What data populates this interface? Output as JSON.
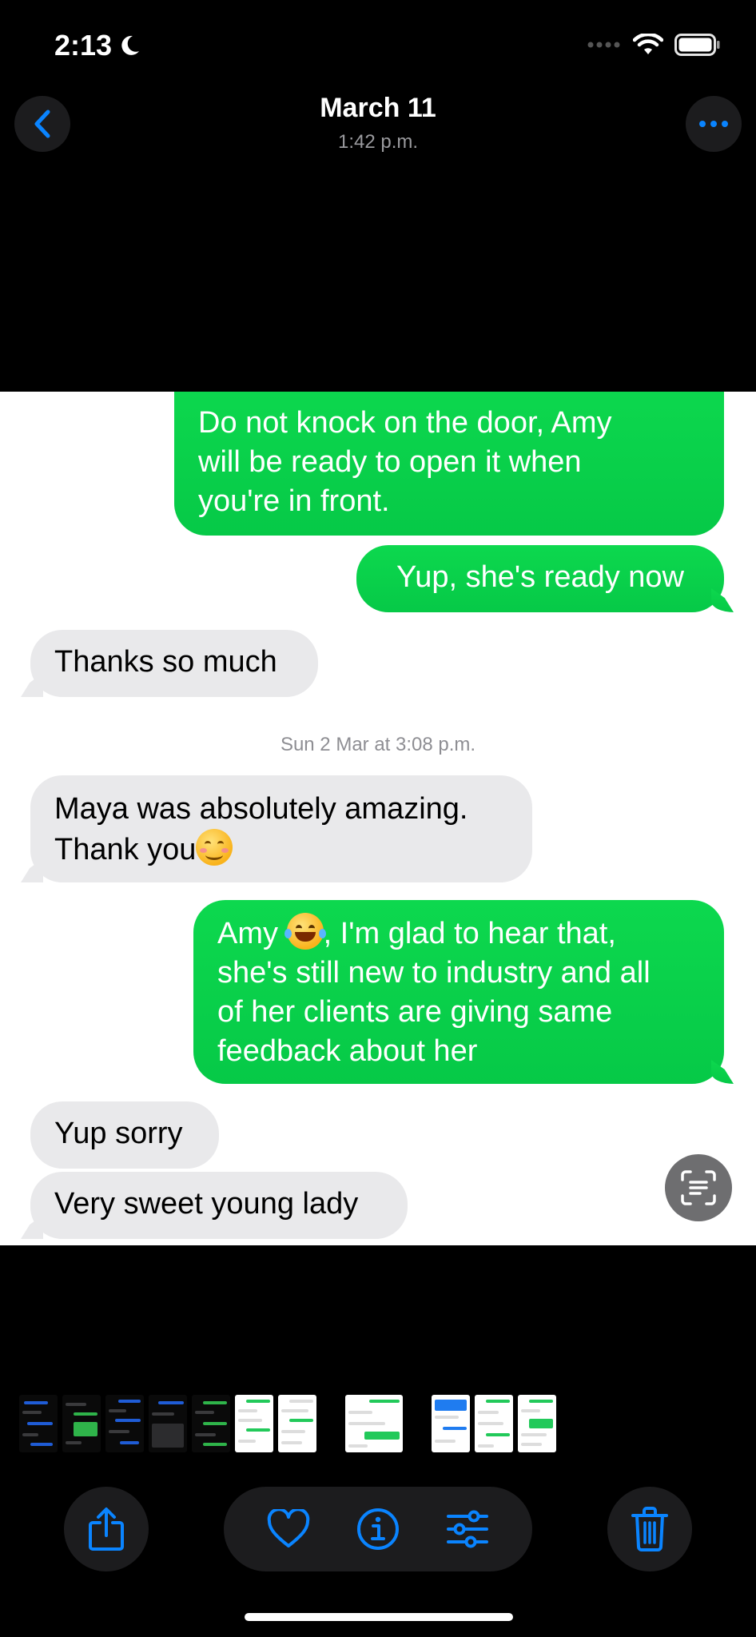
{
  "status_bar": {
    "time": "2:13",
    "focus_icon": "moon-icon",
    "signal_icon": "signal-dots-icon",
    "wifi_icon": "wifi-icon",
    "battery_icon": "battery-icon"
  },
  "nav": {
    "back_icon": "chevron-left-icon",
    "title": "March 11",
    "subtitle": "1:42 p.m.",
    "more_icon": "ellipsis-icon"
  },
  "photo": {
    "messages": [
      {
        "side": "sent",
        "lines": [
          "Do not knock on the door, Amy",
          "will be ready to open it when",
          "you're in front."
        ]
      },
      {
        "side": "sent",
        "lines": [
          "Yup, she's ready now"
        ]
      },
      {
        "side": "received",
        "lines": [
          "Thanks so much"
        ]
      },
      {
        "side": "received",
        "lines": [
          "Maya was absolutely amazing.",
          "Thank you"
        ],
        "emoji": "smiling-face-emoji"
      },
      {
        "side": "sent",
        "lines": [
          "Amy",
          ", I'm glad to hear that,",
          "she's still new to industry and all",
          "of her clients are giving same",
          "feedback about her"
        ],
        "emoji": "tears-of-joy-emoji"
      },
      {
        "side": "received",
        "lines": [
          "Yup sorry"
        ]
      },
      {
        "side": "received",
        "lines": [
          "Very sweet young lady"
        ]
      }
    ],
    "timestamp": "Sun 2 Mar at 3:08 p.m.",
    "live_text_icon": "live-text-icon"
  },
  "toolbar": {
    "share_icon": "share-icon",
    "favorite_icon": "heart-icon",
    "info_icon": "info-icon",
    "adjust_icon": "sliders-icon",
    "delete_icon": "trash-icon"
  },
  "colors": {
    "accent": "#0a84ff",
    "sent_bubble": "#08d04b",
    "received_bubble": "#e9e9eb",
    "toolbar_bg": "#1c1c1e"
  }
}
